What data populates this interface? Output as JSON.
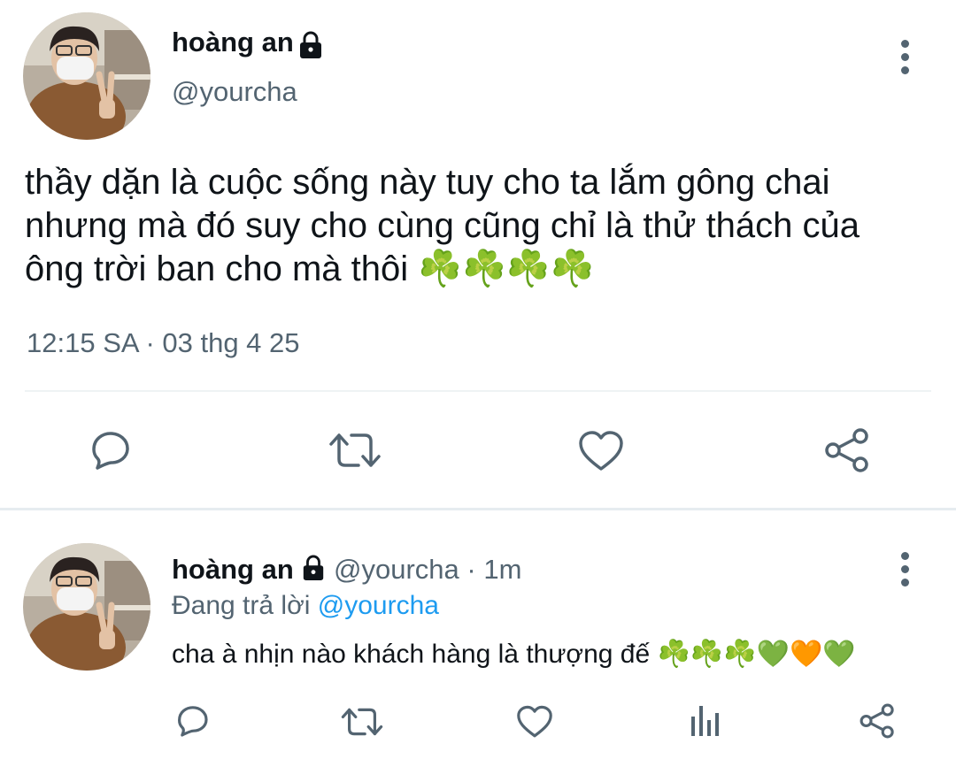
{
  "main_tweet": {
    "display_name": "hoàng an",
    "handle": "@yourcha",
    "text": "thầy dặn là cuộc sống này tuy cho ta lắm gông chai nhưng mà đó suy cho cùng cũng chỉ là thử thách của ông trời ban cho mà thôi",
    "emojis": "☘️☘️☘️☘️",
    "timestamp": "12:15 SA · 03 thg 4 25",
    "icons": {
      "protected": "lock-icon",
      "more": "more-vertical-icon",
      "reply": "reply-bubble-icon",
      "retweet": "retweet-icon",
      "like": "heart-icon",
      "share": "share-icon"
    }
  },
  "reply_tweet": {
    "display_name": "hoàng an",
    "handle": "@yourcha",
    "time_ago": "· 1m",
    "replying_prefix": "Đang trả lời",
    "replying_to": "@yourcha",
    "text": "cha à nhịn nào khách hàng là thượng đế",
    "emojis": [
      "☘️",
      "☘️",
      "☘️",
      "💚",
      "🧡",
      "💚"
    ],
    "icons": {
      "reply": "reply-bubble-icon",
      "retweet": "retweet-icon",
      "like": "heart-icon",
      "analytics": "analytics-icon",
      "share": "share-icon"
    }
  },
  "colors": {
    "text": "#0f1419",
    "secondary": "#536471",
    "link": "#1d9bf0",
    "divider": "#eff3f4",
    "clover": "#53b33b",
    "green_heart": "#78b159",
    "orange_heart": "#f4900c"
  }
}
